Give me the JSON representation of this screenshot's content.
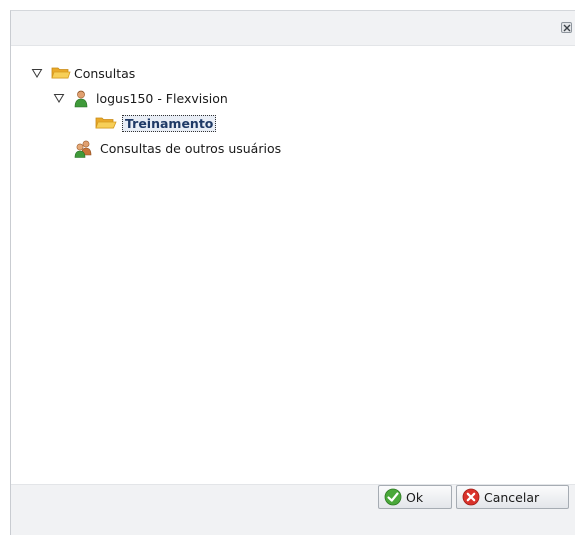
{
  "dialog": {
    "close_icon": "close-icon"
  },
  "tree": {
    "root": {
      "label": "Consultas",
      "icon": "folder-open-icon",
      "expanded": true
    },
    "user": {
      "label": "logus150 - Flexvision",
      "icon": "user-icon",
      "expanded": true
    },
    "folder": {
      "label": "Treinamento",
      "icon": "folder-open-icon",
      "selected": true
    },
    "others": {
      "label": "Consultas de outros usuários",
      "icon": "users-group-icon"
    }
  },
  "buttons": {
    "ok_label": "Ok",
    "cancel_label": "Cancelar"
  },
  "colors": {
    "ok_green": "#4aa83a",
    "cancel_red": "#d9322b",
    "folder_yellow": "#f5c343",
    "selection_text": "#1f3a66"
  }
}
